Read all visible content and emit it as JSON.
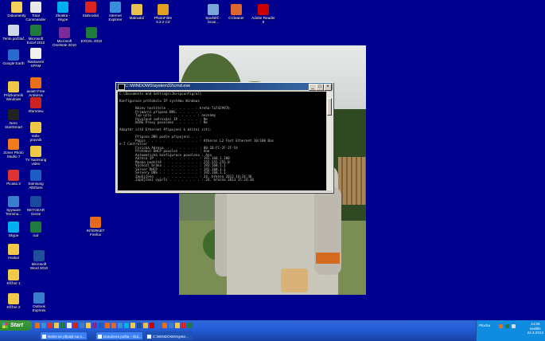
{
  "desktop_icons": [
    {
      "id": "dokumenty",
      "label": "Dokumenty",
      "color": "#f5d15a"
    },
    {
      "id": "total-commander",
      "label": "Total\nCommander",
      "color": "#e8e8e8"
    },
    {
      "id": "zkratka-skype",
      "label": "Zkratka -\nSkype",
      "color": "#00aff0"
    },
    {
      "id": "stahovani",
      "label": "Stahování",
      "color": "#d22"
    },
    {
      "id": "internet-explorer",
      "label": "Internet\nExplorer",
      "color": "#3b8ede"
    },
    {
      "id": "malovani",
      "label": "Malování",
      "color": "#e8c050"
    },
    {
      "id": "photofiltre",
      "label": "PhotoFiltre\n6.3.2 CZ",
      "color": "#e0a020"
    },
    {
      "id": "spoustec",
      "label": "Spoštěč -\nScan...",
      "color": "#7aa6d8"
    },
    {
      "id": "ccleaner",
      "label": "CCleaner",
      "color": "#d63"
    },
    {
      "id": "adobe-reader",
      "label": "Adobe Reader\n9",
      "color": "#c00"
    },
    {
      "id": "tento-pocitac",
      "label": "Tento počítač",
      "color": "#cfd8e8"
    },
    {
      "id": "excel-2010",
      "label": "Microsoft\nExcel 2010",
      "color": "#1e7a3d"
    },
    {
      "id": "onenote-2010",
      "label": "Microsoft\nOneNote 2010",
      "color": "#7a2a9a"
    },
    {
      "id": "excel-zkratka",
      "label": "EXCEL 2010",
      "color": "#1e7a3d"
    },
    {
      "id": "google-earth",
      "label": "Google Earth",
      "color": "#2a6ad0"
    },
    {
      "id": "nastaveni-spam",
      "label": "Nastavení\nSPAM",
      "color": "#f0f0f0"
    },
    {
      "id": "prohlizenik",
      "label": "Průzkumník\nWindows",
      "color": "#f0c84a"
    },
    {
      "id": "avast",
      "label": "avast! Free\nAntivirus",
      "color": "#e86e1a"
    },
    {
      "id": "nero",
      "label": "Nero\nStartSmart",
      "color": "#222"
    },
    {
      "id": "irfanview",
      "label": "IrfanView",
      "color": "#c22"
    },
    {
      "id": "zoner",
      "label": "Zoner Photo\nStudio 7",
      "color": "#f07b1a"
    },
    {
      "id": "rada-pravnik",
      "label": "rada-\npravnik",
      "color": "#f0c84a"
    },
    {
      "id": "picasa",
      "label": "Picasa 3",
      "color": "#d33"
    },
    {
      "id": "tv-samsung",
      "label": "TV Samsung\nvideo",
      "color": "#f0c84a"
    },
    {
      "id": "samsung-allshare",
      "label": "Samsung\nAllShare",
      "color": "#1a5dc6"
    },
    {
      "id": "spyware",
      "label": "Spyware\nTermina...",
      "color": "#3a7cd0"
    },
    {
      "id": "netgear",
      "label": "NETGEAR\nGenie",
      "color": "#1a4aa0"
    },
    {
      "id": "skype",
      "label": "Skype",
      "color": "#00aff0"
    },
    {
      "id": "icul",
      "label": "icul",
      "color": "#1e7a3d"
    },
    {
      "id": "internet-firefox",
      "label": "INTERNET\nFirefox",
      "color": "#e66a1a"
    },
    {
      "id": "hrabal",
      "label": "Hrabal",
      "color": "#f0c84a"
    },
    {
      "id": "word-2010",
      "label": "Microsoft\nWord 2010",
      "color": "#1f4e9c"
    },
    {
      "id": "krizne1",
      "label": "Křížné 1",
      "color": "#f0c84a"
    },
    {
      "id": "krizne2",
      "label": "Křížné 2",
      "color": "#f0c84a"
    },
    {
      "id": "outlook-express",
      "label": "Outlook\nExpress",
      "color": "#3a7cd0"
    }
  ],
  "cmd_window": {
    "title": "C:\\WINDOWS\\system32\\cmd.exe",
    "minimize": "_",
    "maximize": "□",
    "close": "×",
    "output": "C:\\Documents and Settings\\Jk>ipconfig/all\n\nKonfigurace protokolu IP systému Windows\n\n        Název hostitele . . . . . . . : kreha-7a742997b\n        Primární přípona DNS. . . . . . :\n        Typ uzlu . . . . . . . . . . . : neznámý\n        Povolené směrování IP . . . . . : Ne\n        WINS Proxy povoleno . . . . . . : Ne\n\nAdaptér sítě Ethernet Připojení k místní síti:\n\n        Přípona DNS podle připojení . . :\n        Popis . . . . . . . . . . . . . : Atheros L2 Fast Ethernet 10/100 Bas\ne-T Controller\n        Fyzická Adresa. . . . . . . . . : 00-1B-FC-2F-2F-54\n        Protokol DHCP povolen . . . . . : Ano\n        Automatická konfigurace povolena : Ano\n        Adresa IP . . . . . . . . . . . : 192.168.1.100\n        Maska podsítě . . . . . . . . . : 255.255.255.0\n        Výchozí brána . . . . . . . . . : 192.168.1.1\n        Server DHCP . . . . . . . . . . : 192.168.1.1\n        Servery DNS . . . . . . . . . . : 192.168.1.1\n        Zapůjčeno . . . . . . . . . . . : 24. března 2013 14:24:30\n        Zapůjčení vyprší . . . . . . . . : 24. března 2013 15:24:30"
  },
  "taskbar": {
    "start_label": "Start",
    "quick_launch_colors": [
      "#e86e1a",
      "#3b8ede",
      "#d33",
      "#f0c84a",
      "#1e7a3d",
      "#e8e8e8",
      "#c22",
      "#3a7cd0",
      "#f0c84a",
      "#7a2a9a",
      "#1a5dc6",
      "#e66a1a",
      "#d63",
      "#3b8ede",
      "#00aff0",
      "#f0c84a",
      "#1f4e9c",
      "#e8c050",
      "#c00",
      "#2a6ad0",
      "#e86e1a",
      "#3a7cd0",
      "#f0c84a",
      "#d22",
      "#1e7a3d"
    ],
    "tasks": [
      {
        "label": "Nelze se připojit na s...",
        "active": false
      },
      {
        "label": "Doručená pošta - Out...",
        "active": false
      },
      {
        "label": "C:\\WINDOWS\\syste...",
        "active": true
      }
    ],
    "tray": {
      "language": "Plocha",
      "time": "14:28",
      "day": "neděle",
      "date": "24.3.2013"
    }
  }
}
